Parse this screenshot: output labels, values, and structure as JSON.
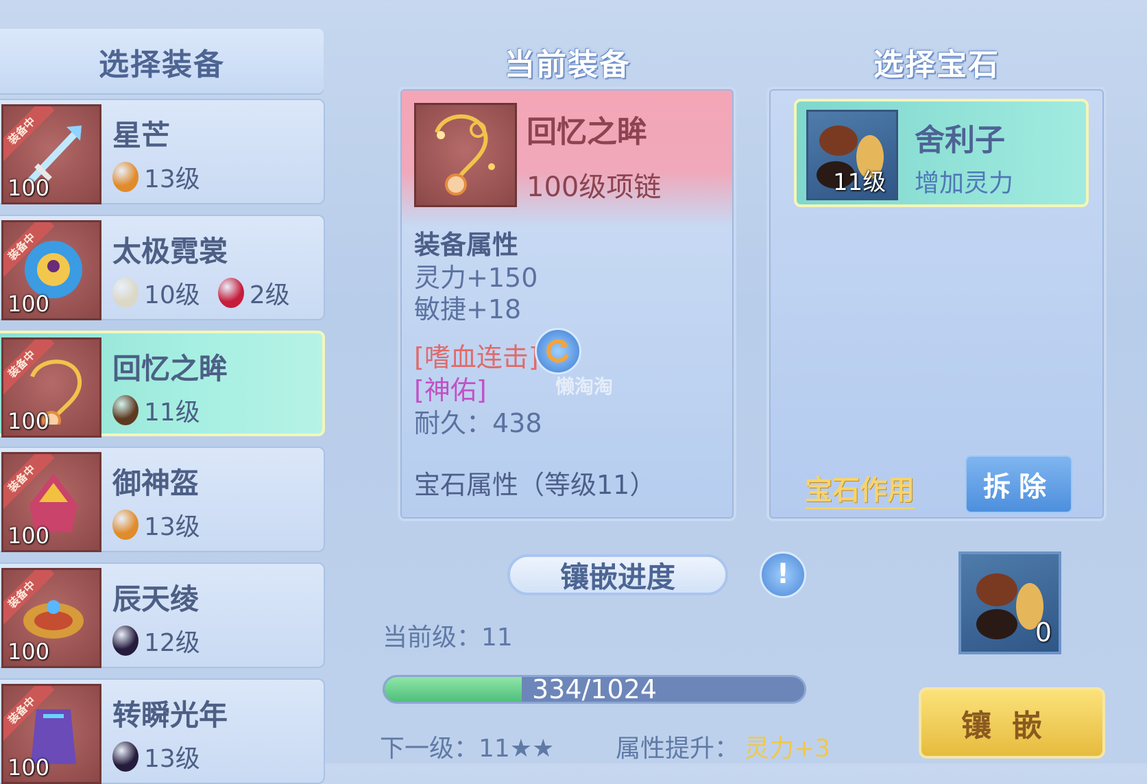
{
  "left": {
    "header": "选择装备",
    "equip_badge": "装备中",
    "items": [
      {
        "name": "星芒",
        "level": "100",
        "gems": [
          {
            "color": "#e08b2c",
            "level": "13级"
          }
        ]
      },
      {
        "name": "太极霓裳",
        "level": "100",
        "gems": [
          {
            "color": "#dcd8c6",
            "level": "10级"
          },
          {
            "color": "#c51d3b",
            "level": "2级"
          }
        ]
      },
      {
        "name": "回忆之眸",
        "level": "100",
        "gems": [
          {
            "color": "#5e3a22",
            "level": "11级"
          }
        ]
      },
      {
        "name": "御神盔",
        "level": "100",
        "gems": [
          {
            "color": "#e08b2c",
            "level": "13级"
          }
        ]
      },
      {
        "name": "辰天绫",
        "level": "100",
        "gems": [
          {
            "color": "#251b3c",
            "level": "12级"
          }
        ]
      },
      {
        "name": "转瞬光年",
        "level": "100",
        "gems": [
          {
            "color": "#251b3c",
            "level": "13级"
          }
        ]
      }
    ]
  },
  "current": {
    "title": "当前装备",
    "name": "回忆之眸",
    "type": "100级项链",
    "attr_title": "装备属性",
    "attrs": [
      "灵力+150",
      "敏捷+18"
    ],
    "skill1": "[嗜血连击]",
    "skill2": "[神佑]",
    "durability": "耐久：438",
    "gem_attr_title": "宝石属性（等级11）"
  },
  "gem": {
    "title": "选择宝石",
    "name": "舍利子",
    "level": "11级",
    "desc": "增加灵力",
    "effect_link": "宝石作用",
    "remove_button": "拆除",
    "slot_count": "0"
  },
  "progress": {
    "label": "镶嵌进度",
    "current_level": "当前级：11",
    "value": 334,
    "max": 1024,
    "text": "334/1024",
    "next_level": "下一级：11★★",
    "boost_label": "属性提升：",
    "boost_value": "灵力+3",
    "inlay_button": "镶嵌"
  },
  "watermark": "懒淘淘"
}
